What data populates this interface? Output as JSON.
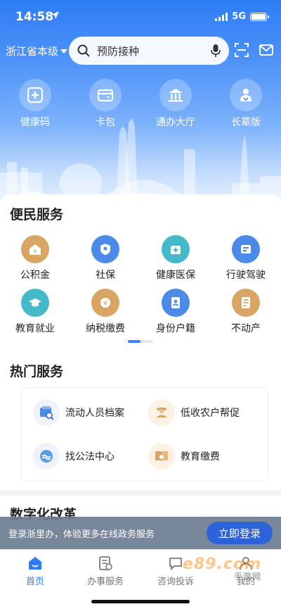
{
  "status": {
    "time": "14:58",
    "network": "5G"
  },
  "header": {
    "region": "浙江省本级",
    "search_placeholder": "预防接种",
    "quick": [
      {
        "label": "健康码",
        "icon": "health-code-icon"
      },
      {
        "label": "卡包",
        "icon": "card-wallet-icon"
      },
      {
        "label": "通办大厅",
        "icon": "service-hall-icon"
      },
      {
        "label": "长辈版",
        "icon": "elder-mode-icon"
      }
    ]
  },
  "convenience": {
    "title": "便民服务",
    "items": [
      {
        "label": "公积金",
        "color": "#d9a562"
      },
      {
        "label": "社保",
        "color": "#4b8ae8"
      },
      {
        "label": "健康医保",
        "color": "#43b9c9"
      },
      {
        "label": "行驶驾驶",
        "color": "#4b8ae8"
      },
      {
        "label": "教育就业",
        "color": "#43b9c9"
      },
      {
        "label": "纳税缴费",
        "color": "#d9a562"
      },
      {
        "label": "身份户籍",
        "color": "#4b8ae8"
      },
      {
        "label": "不动产",
        "color": "#d9a562"
      }
    ]
  },
  "hot": {
    "title": "热门服务",
    "items": [
      {
        "label": "流动人员档案",
        "icon": "archive-icon"
      },
      {
        "label": "低收农户帮促",
        "icon": "farmer-aid-icon"
      },
      {
        "label": "找公法中心",
        "icon": "legal-center-icon"
      },
      {
        "label": "教育缴费",
        "icon": "education-fee-icon"
      }
    ]
  },
  "digital": {
    "title": "数字化改革"
  },
  "login": {
    "prompt": "登录浙里办，体验更多在线政务服务",
    "button": "立即登录"
  },
  "tabbar": {
    "tabs": [
      {
        "label": "首页",
        "active": true
      },
      {
        "label": "办事服务",
        "active": false
      },
      {
        "label": "咨询投诉",
        "active": false
      },
      {
        "label": "我的",
        "active": false
      }
    ]
  },
  "watermark": {
    "text": "e89.com",
    "sub": "手游网"
  }
}
